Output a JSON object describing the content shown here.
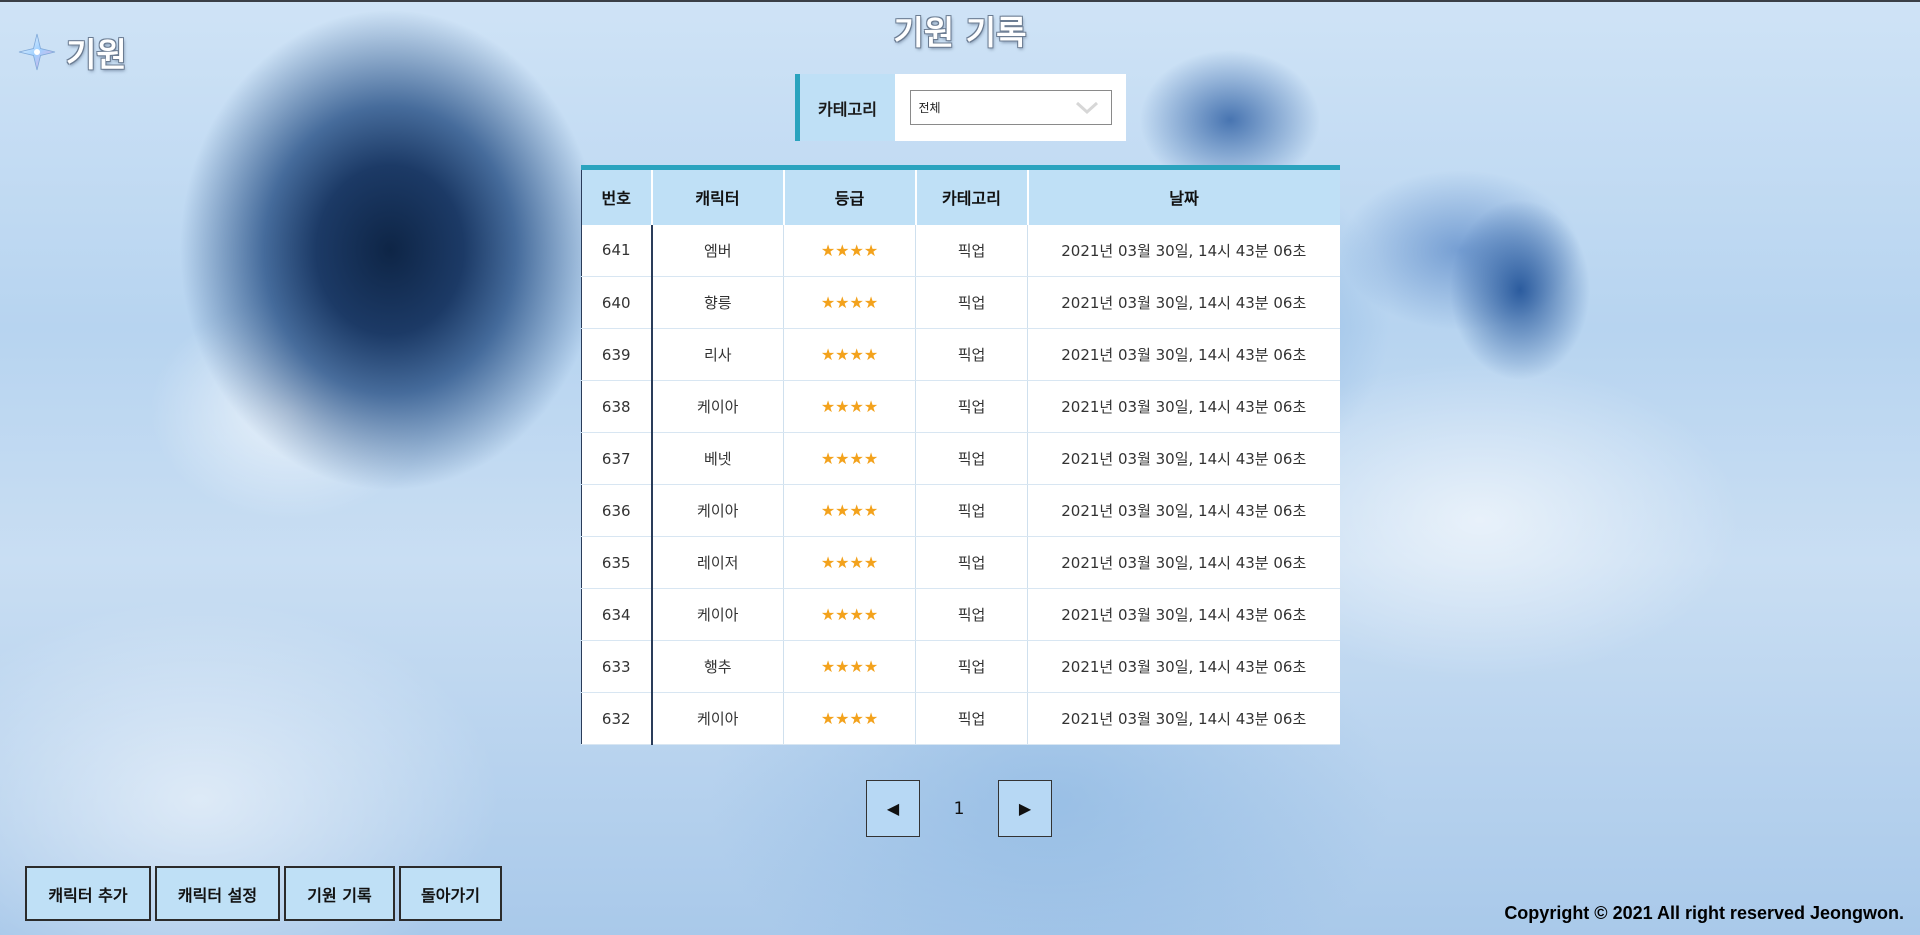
{
  "app": {
    "logo_text": "기원"
  },
  "page": {
    "title": "기원 기록"
  },
  "filter": {
    "label": "카테고리",
    "selected": "전체"
  },
  "table": {
    "headers": [
      "번호",
      "캐릭터",
      "등급",
      "카테고리",
      "날짜"
    ],
    "rows": [
      {
        "no": "641",
        "character": "엠버",
        "grade": "★★★★",
        "category": "픽업",
        "date": "2021년 03월 30일, 14시 43분 06초"
      },
      {
        "no": "640",
        "character": "향릉",
        "grade": "★★★★",
        "category": "픽업",
        "date": "2021년 03월 30일, 14시 43분 06초"
      },
      {
        "no": "639",
        "character": "리사",
        "grade": "★★★★",
        "category": "픽업",
        "date": "2021년 03월 30일, 14시 43분 06초"
      },
      {
        "no": "638",
        "character": "케이아",
        "grade": "★★★★",
        "category": "픽업",
        "date": "2021년 03월 30일, 14시 43분 06초"
      },
      {
        "no": "637",
        "character": "베넷",
        "grade": "★★★★",
        "category": "픽업",
        "date": "2021년 03월 30일, 14시 43분 06초"
      },
      {
        "no": "636",
        "character": "케이아",
        "grade": "★★★★",
        "category": "픽업",
        "date": "2021년 03월 30일, 14시 43분 06초"
      },
      {
        "no": "635",
        "character": "레이저",
        "grade": "★★★★",
        "category": "픽업",
        "date": "2021년 03월 30일, 14시 43분 06초"
      },
      {
        "no": "634",
        "character": "케이아",
        "grade": "★★★★",
        "category": "픽업",
        "date": "2021년 03월 30일, 14시 43분 06초"
      },
      {
        "no": "633",
        "character": "행추",
        "grade": "★★★★",
        "category": "픽업",
        "date": "2021년 03월 30일, 14시 43분 06초"
      },
      {
        "no": "632",
        "character": "케이아",
        "grade": "★★★★",
        "category": "픽업",
        "date": "2021년 03월 30일, 14시 43분 06초"
      }
    ]
  },
  "pagination": {
    "prev_label": "◀",
    "current_page": "1",
    "next_label": "▶"
  },
  "bottom_nav": [
    "캐릭터 추가",
    "캐릭터 설정",
    "기원 기록",
    "돌아가기"
  ],
  "footer": {
    "copyright": "Copyright © 2021 All right reserved Jeongwon."
  },
  "colors": {
    "accent": "#2aa3be",
    "header_bg": "#bfe0f6",
    "star": "#f3a21c"
  },
  "icons": {
    "logo": "intertwined-fate-star-icon",
    "select": "chevron-down-icon"
  }
}
